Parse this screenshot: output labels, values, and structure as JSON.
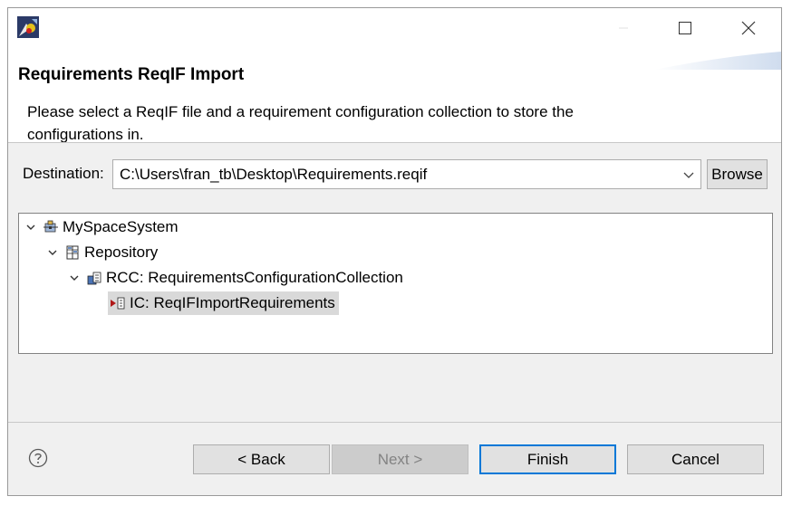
{
  "window": {
    "icon": "app-icon"
  },
  "header": {
    "title": "Requirements ReqIF Import",
    "message": "Please select a ReqIF file and a requirement configuration collection to store the configurations in."
  },
  "destination": {
    "label": "Destination:",
    "value": "C:\\Users\\fran_tb\\Desktop\\Requirements.reqif",
    "browse_label": "Browse"
  },
  "tree": {
    "items": [
      {
        "label": "MySpaceSystem",
        "icon": "space-system-icon",
        "expanded": true
      },
      {
        "label": "Repository",
        "icon": "repository-icon",
        "expanded": true
      },
      {
        "label": "RCC: RequirementsConfigurationCollection",
        "icon": "configuration-collection-icon",
        "expanded": true
      },
      {
        "label": "IC: ReqIFImportRequirements",
        "icon": "import-configuration-icon",
        "selected": true
      }
    ]
  },
  "buttons": {
    "back": "< Back",
    "next": "Next >",
    "finish": "Finish",
    "cancel": "Cancel"
  },
  "colors": {
    "accent": "#0078d7",
    "selection": "#d9d9d9"
  }
}
